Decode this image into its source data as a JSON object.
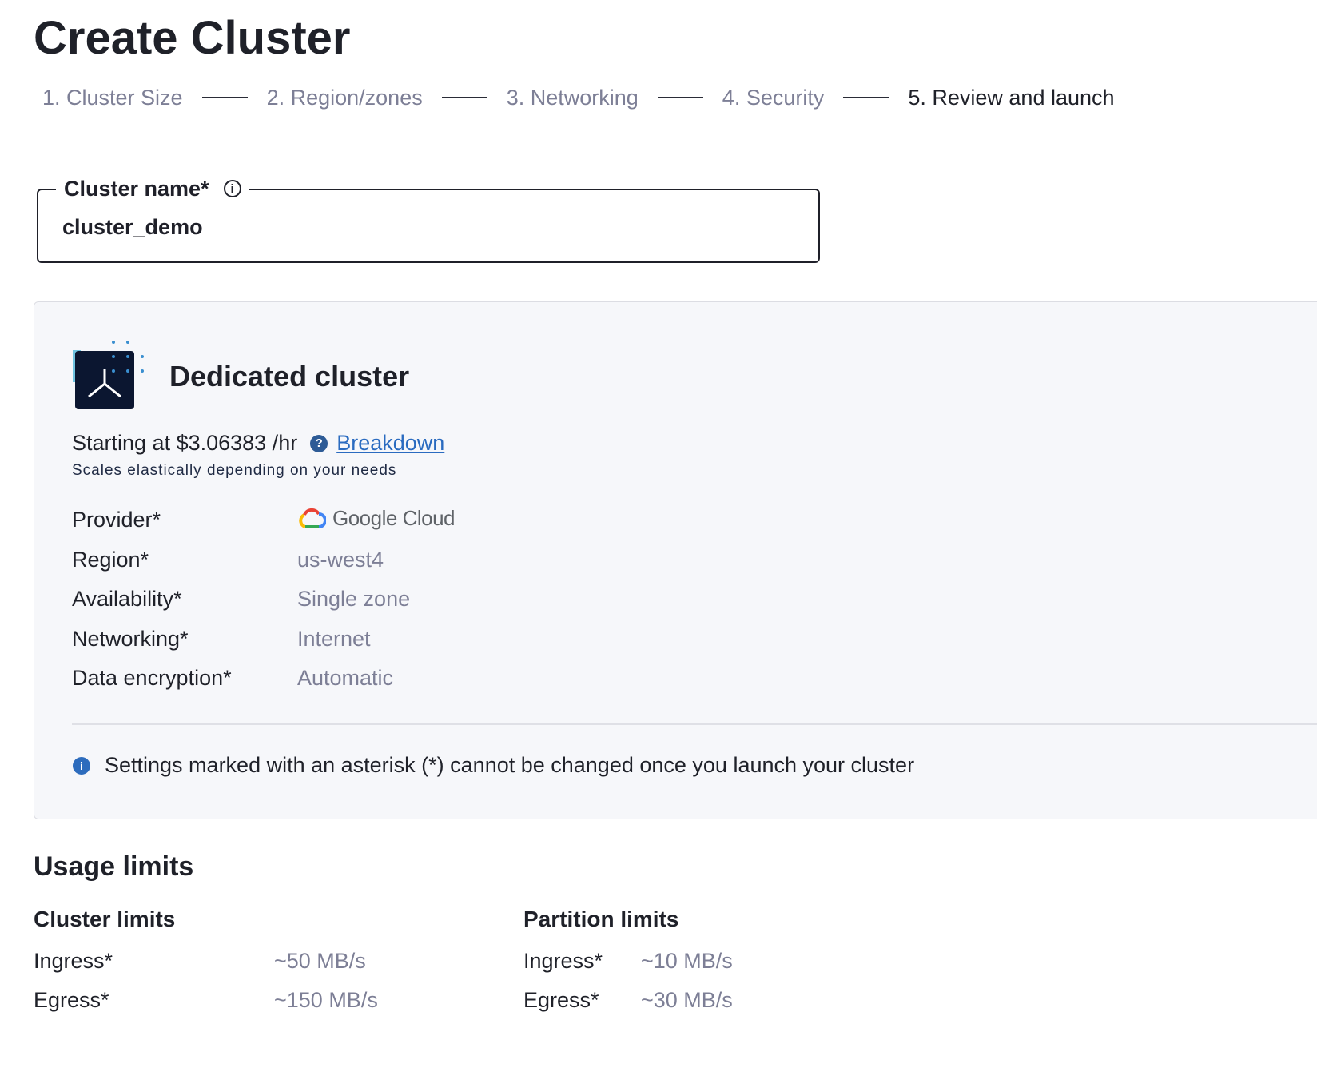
{
  "page_title": "Create Cluster",
  "steps": [
    {
      "label": "1. Cluster Size"
    },
    {
      "label": "2. Region/zones"
    },
    {
      "label": "3. Networking"
    },
    {
      "label": "4. Security"
    },
    {
      "label": "5. Review and launch"
    }
  ],
  "cluster_name": {
    "label": "Cluster name*",
    "value": "cluster_demo"
  },
  "card": {
    "title": "Dedicated cluster",
    "price": "Starting at $3.06383 /hr",
    "breakdown_link": "Breakdown",
    "subnote": "Scales elastically depending on your needs",
    "specs": [
      {
        "label": "Provider*",
        "value": "Google Cloud"
      },
      {
        "label": "Region*",
        "value": "us-west4"
      },
      {
        "label": "Availability*",
        "value": "Single zone"
      },
      {
        "label": "Networking*",
        "value": "Internet"
      },
      {
        "label": "Data encryption*",
        "value": "Automatic"
      }
    ],
    "note": "Settings marked with an asterisk (*) cannot be changed once you launch your cluster"
  },
  "usage": {
    "title": "Usage limits",
    "cluster_limits": {
      "title": "Cluster limits",
      "rows": [
        {
          "label": "Ingress*",
          "value": "~50 MB/s"
        },
        {
          "label": "Egress*",
          "value": "~150 MB/s"
        }
      ]
    },
    "partition_limits": {
      "title": "Partition limits",
      "rows": [
        {
          "label": "Ingress*",
          "value": "~10 MB/s"
        },
        {
          "label": "Egress*",
          "value": "~30 MB/s"
        }
      ]
    }
  },
  "colors": {
    "accent_link": "#2a6bc0",
    "muted_text": "#7d7f96",
    "card_bg": "#f6f7fa"
  }
}
